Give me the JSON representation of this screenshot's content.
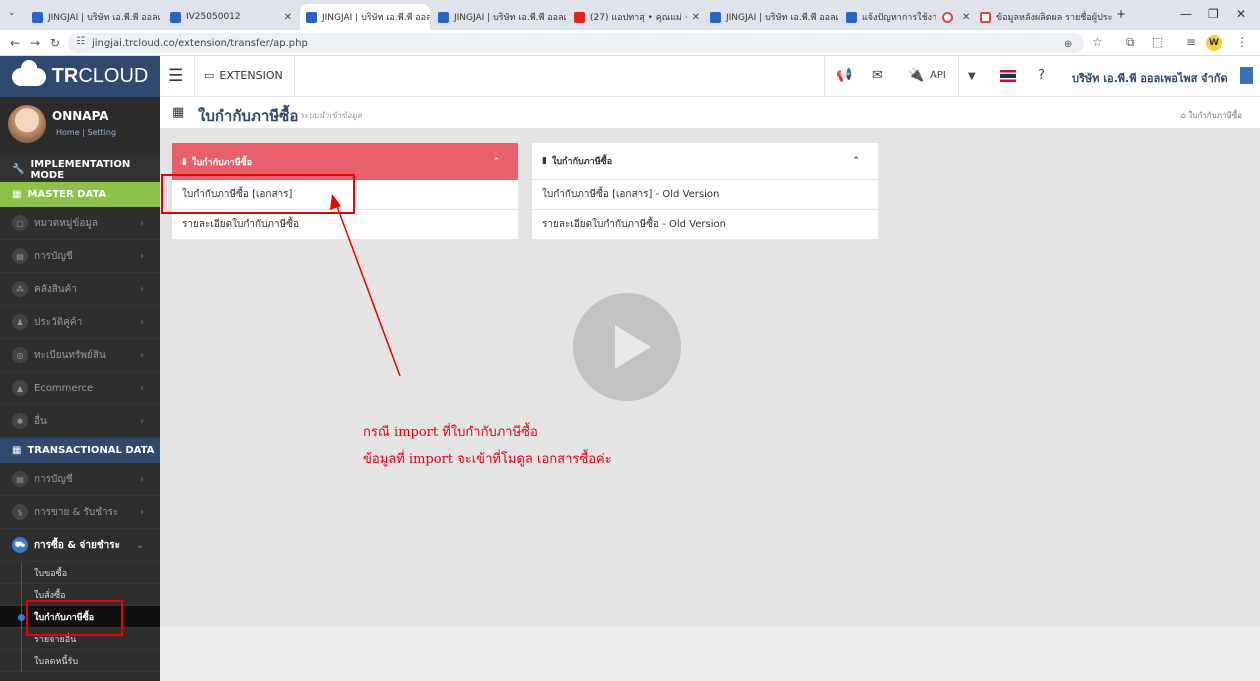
{
  "browser": {
    "tabs": [
      {
        "label": "JINGJAI | บริษัท เอ.พี.พี ออลเ",
        "icon": "doc"
      },
      {
        "label": "IV25050012",
        "icon": "doc"
      },
      {
        "label": "JINGJAI | บริษัท เอ.พี.พี ออลเ",
        "icon": "doc",
        "active": true
      },
      {
        "label": "JINGJAI | บริษัท เอ.พี.พี ออลเ",
        "icon": "doc"
      },
      {
        "label": "(27) แอปทาสุ • คุณแม่ ·",
        "icon": "youtube"
      },
      {
        "label": "JINGJAI | บริษัท เอ.พี.พี ออลเ",
        "icon": "doc"
      },
      {
        "label": "แจ้งปัญหาการใช้งาน",
        "icon": "doc"
      },
      {
        "label": "",
        "icon": "record"
      },
      {
        "label": "ข้อมูลหลังผลิตผล รายชื่อผู้ประ",
        "icon": "sheet"
      }
    ],
    "url": "jingjai.trcloud.co/extension/transfer/ap.php"
  },
  "app": {
    "logo_bold": "TR",
    "logo_rest": "CLOUD",
    "top_nav": {
      "extension_label": "EXTENSION",
      "api_label": "API",
      "company": "บริษัท เอ.พี.พี ออลเพอไพส จำกัด"
    },
    "user": {
      "name": "ONNAPA",
      "links": "Home | Setting"
    },
    "sidebar": {
      "implementation": "IMPLEMENTATION MODE",
      "master": "MASTER DATA",
      "master_items": [
        {
          "label": "หมวดหมู่ข้อมูล",
          "icon": "▢"
        },
        {
          "label": "การบัญชี",
          "icon": "▤"
        },
        {
          "label": "คลังสินค้า",
          "icon": "⁂"
        },
        {
          "label": "ประวัติคู่ค้า",
          "icon": "♟"
        },
        {
          "label": "ทะเบียนทรัพย์สิน",
          "icon": "◎"
        },
        {
          "label": "Ecommerce",
          "icon": "▲"
        },
        {
          "label": "อื่น",
          "icon": "✱"
        }
      ],
      "transactional": "TRANSACTIONAL DATA",
      "trans_items": [
        {
          "label": "การบัญชี",
          "icon": "▤"
        },
        {
          "label": "การขาย & รับชำระ",
          "icon": "$"
        }
      ],
      "open_item": {
        "label": "การซื้อ & จ่ายชำระ",
        "icon": "⛟"
      },
      "sub_items": [
        "ใบขอซื้อ",
        "ใบสั่งซื้อ",
        "ใบกำกับภาษีซื้อ",
        "รายจ่ายอื่น",
        "ใบลดหนี้รับ"
      ]
    },
    "page": {
      "title": "ใบกำกับภาษีซื้อ",
      "subtitle": "ระบบนำเข้าข้อมูล",
      "breadcrumb": "ใบกำกับภาษีซื้อ"
    },
    "panels": [
      {
        "title": "ใบกำกับภาษีซื้อ",
        "rows": [
          "ใบกำกับภาษีซื้อ [เอกสาร]",
          "รายละเอียดใบกำกับภาษีซื้อ"
        ]
      },
      {
        "title": "ใบกำกับภาษีซื้อ",
        "rows": [
          "ใบกำกับภาษีซื้อ [เอกสาร] - Old Version",
          "รายละเอียดใบกำกับภาษีซื้อ - Old Version"
        ]
      }
    ],
    "annotation": {
      "line1": "กรณี import ที่ใบกำกับภาษีซื้อ",
      "line2": "ข้อมูลที่ import จะเข้าที่โมดูล เอกสารซื้อค่ะ"
    }
  }
}
